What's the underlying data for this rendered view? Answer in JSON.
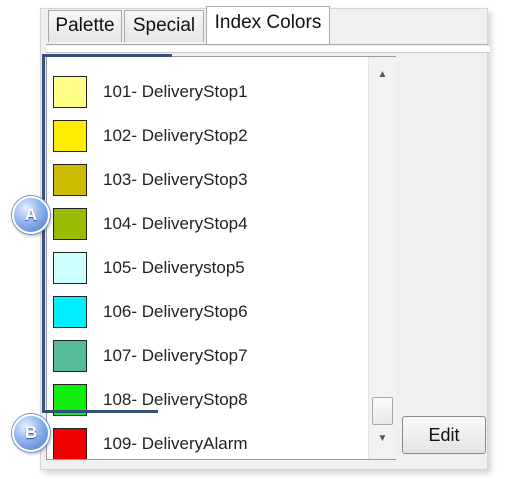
{
  "tabs": [
    {
      "label": "Palette"
    },
    {
      "label": "Special"
    },
    {
      "label": "Index Colors"
    }
  ],
  "list": {
    "items": [
      {
        "label": "101- DeliveryStop1",
        "color": "#ffff88"
      },
      {
        "label": "102- DeliveryStop2",
        "color": "#ffee00"
      },
      {
        "label": "103- DeliveryStop3",
        "color": "#ccbb00"
      },
      {
        "label": "104- DeliveryStop4",
        "color": "#99bb00"
      },
      {
        "label": "105- Deliverystop5",
        "color": "#ccffff"
      },
      {
        "label": "106- DeliveryStop6",
        "color": "#00eeff"
      },
      {
        "label": "107- DeliveryStop7",
        "color": "#55bb99"
      },
      {
        "label": "108- DeliveryStop8",
        "color": "#11ee11"
      },
      {
        "label": "109- DeliveryAlarm",
        "color": "#ee0000"
      }
    ]
  },
  "scrollbar": {
    "up_icon": "triangle-up",
    "down_icon": "triangle-down"
  },
  "edit_button": {
    "label": "Edit"
  },
  "callouts": {
    "a": "A",
    "b": "B"
  },
  "colors": {
    "bracket": "#35507a",
    "callout": "#6a92da"
  }
}
